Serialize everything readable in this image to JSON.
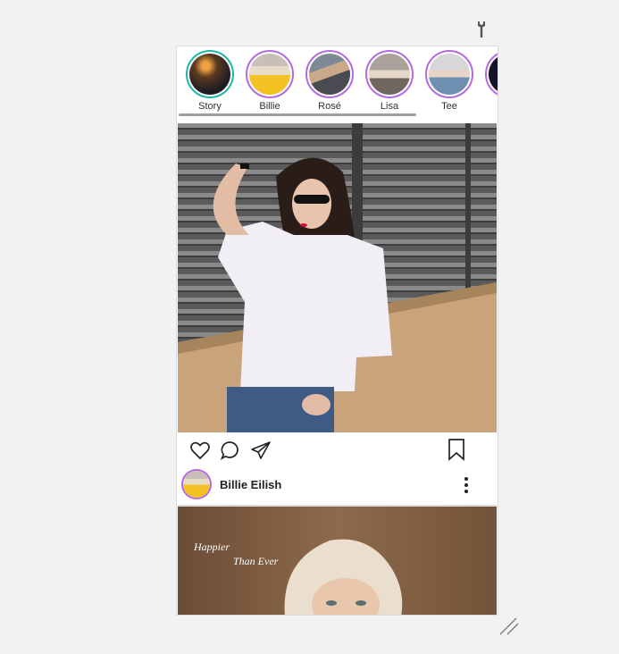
{
  "stories": [
    {
      "label": "Story",
      "own": true
    },
    {
      "label": "Billie",
      "own": false
    },
    {
      "label": "Rosé",
      "own": false
    },
    {
      "label": "Lisa",
      "own": false
    },
    {
      "label": "Tee",
      "own": false
    }
  ],
  "feed": {
    "post1": {
      "author": "Billie Eilish"
    },
    "post2": {
      "caption_line1": "Happier",
      "caption_line2": "Than Ever"
    }
  },
  "icons": {
    "like": "heart-icon",
    "comment": "comment-icon",
    "share": "send-icon",
    "save": "bookmark-icon",
    "more": "more-vertical-icon",
    "settings": "wrench-icon",
    "resize": "resize-handle-icon"
  },
  "colors": {
    "story_ring": "#b36ae2",
    "own_story_ring": "#1fb8a6"
  }
}
